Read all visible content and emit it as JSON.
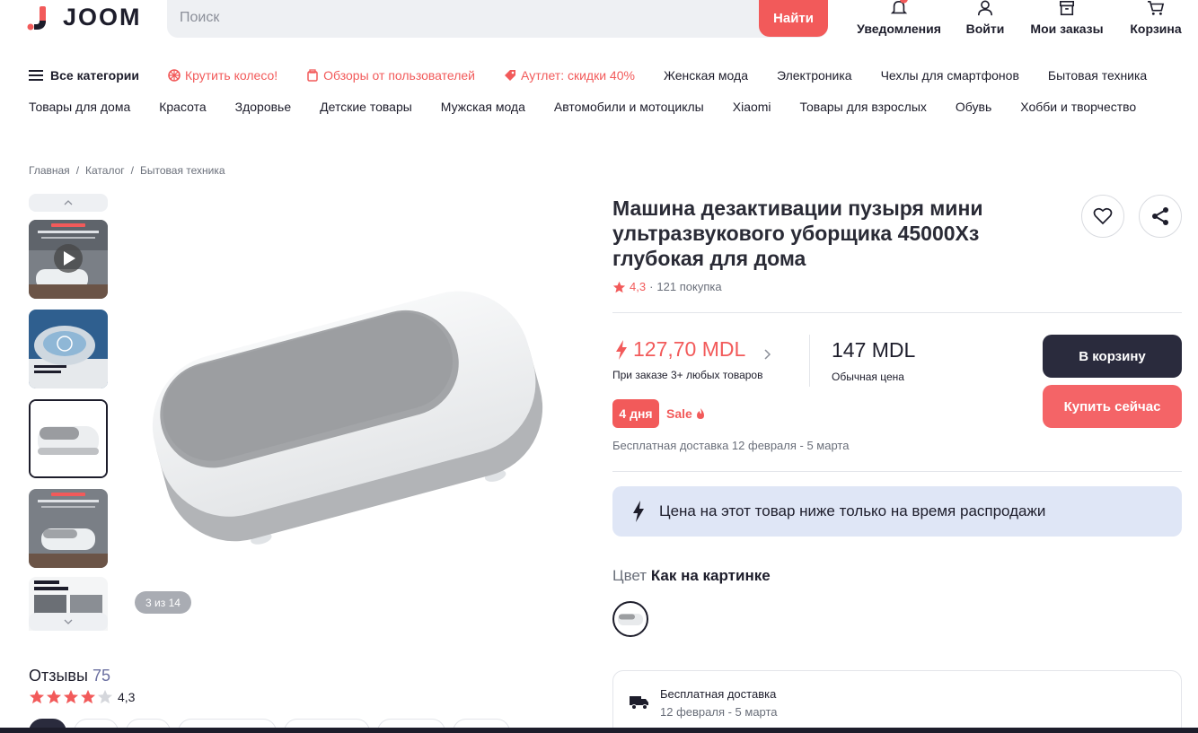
{
  "brand": {
    "name": "JOOM",
    "accent": "#f25a5a",
    "dark": "#2a2b3d"
  },
  "search": {
    "placeholder": "Поиск",
    "button": "Найти"
  },
  "header_nav": [
    {
      "label": "Уведомления",
      "icon": "bell-icon"
    },
    {
      "label": "Войти",
      "icon": "user-icon"
    },
    {
      "label": "Мои заказы",
      "icon": "box-icon"
    },
    {
      "label": "Корзина",
      "icon": "cart-icon"
    }
  ],
  "categories_row1": [
    {
      "label": "Все категории"
    },
    {
      "label": "Крутить колесо!"
    },
    {
      "label": "Обзоры от пользователей"
    },
    {
      "label": "Аутлет: скидки 40%"
    },
    {
      "label": "Женская мода"
    },
    {
      "label": "Электроника"
    },
    {
      "label": "Чехлы для смартфонов"
    },
    {
      "label": "Бытовая техника"
    }
  ],
  "categories_row2": [
    "Товары для дома",
    "Красота",
    "Здоровье",
    "Детские товары",
    "Мужская мода",
    "Автомобили и мотоциклы",
    "Xiaomi",
    "Товары для взрослых",
    "Обувь",
    "Хобби и творчество"
  ],
  "breadcrumb": [
    "Главная",
    "Каталог",
    "Бытовая техника"
  ],
  "gallery": {
    "counter": "3 из 14"
  },
  "product": {
    "title": "Машина дезактивации пузыря мини ультразвукового уборщика 45000Хз глубокая для дома",
    "rating": "4,3",
    "purchases": "121 покупка",
    "sale_price": "127,70 MDL",
    "sale_note": "При заказе 3+ любых товаров",
    "regular_price": "147 MDL",
    "regular_note": "Обычная цена",
    "days_badge": "4 дня",
    "sale_tag": "Sale",
    "delivery": "Бесплатная доставка 12 февраля - 5 марта",
    "cart_button": "В корзину",
    "buy_button": "Купить сейчас",
    "banner": "Цена на этот товар ниже только на время распродажи",
    "color_key": "Цвет",
    "color_value": "Как на картинке"
  },
  "shipping_card": {
    "title": "Бесплатная доставка",
    "dates": "12 февраля - 5 марта"
  },
  "reviews": {
    "title": "Отзывы",
    "count": "75",
    "rating": "4,3",
    "stars": 4.3
  }
}
